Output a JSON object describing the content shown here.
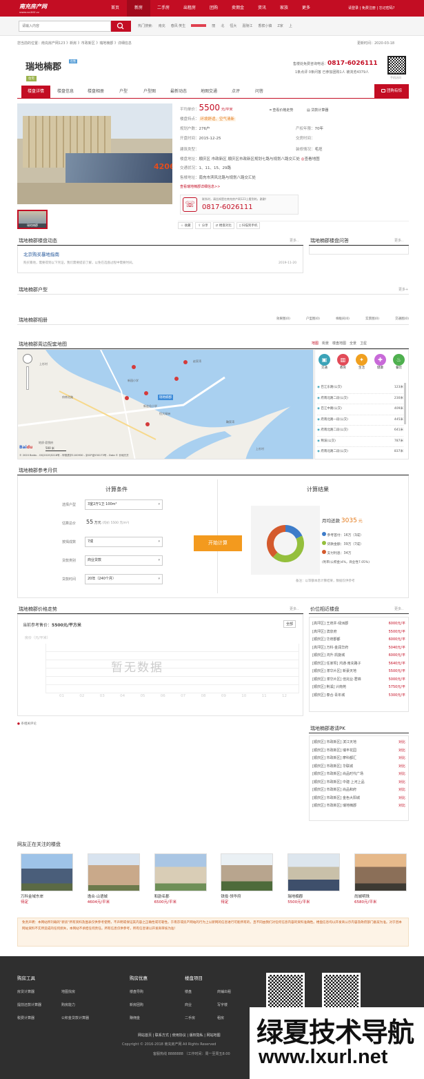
{
  "site": {
    "logo": "南充房产网",
    "logo_url": "www.nc365.cc"
  },
  "topnav": {
    "items": [
      "首页",
      "新房",
      "二手房",
      "出租房",
      "团购",
      "卖佣金",
      "资讯",
      "家族",
      "更多"
    ],
    "login": "请登录",
    "register": "免费注册",
    "forgot": "忘记密码?"
  },
  "search": {
    "placeholder": "请输入内容",
    "hot_label": "热门搜索:",
    "hot": [
      "南充",
      "春风·笑生",
      "",
      "丽",
      "北",
      "恒大",
      "嘉陵江",
      "香槟小镇",
      "Z家",
      "上"
    ]
  },
  "breadcrumb": {
    "text": "您当前的位置：南充房产网123 》新房 》市政新区 》瑞地楠郡 》详细信息",
    "update": "更新时间：2020-03-18"
  },
  "project": {
    "name": "瑞地楠郡",
    "tag_sale": "在售",
    "tag_type": "住宅",
    "phone_label": "售楼处免费咨询电话：",
    "phone": "0817-6026111",
    "stats": "1条点评 0条问答 已参加团购1人 被浏览4379人",
    "qr_caption": "手机访问"
  },
  "tabs": [
    "楼盘详情",
    "楼盘信息",
    "楼盘相册",
    "户型",
    "户型图",
    "最新动态",
    "地图交通",
    "点评",
    "问答"
  ],
  "tuangou_btn": "团购有惊",
  "info": {
    "price_label": "平均单价：",
    "price": "5500",
    "price_unit": "元/平米",
    "price_trend": "查看价格走势",
    "loan_calc": "贷款计算器",
    "feature_label": "楼盘特点：",
    "features": "环境舒适、空气清新",
    "households_label": "规划户数：",
    "households": "276户",
    "years_label": "产权年限：",
    "years": "70年",
    "open_label": "开盘时间：",
    "open": "2015-12-25",
    "deliver_label": "交房时间：",
    "deliver": "",
    "type_label": "建筑类型：",
    "type": "",
    "decor_label": "装修情况：",
    "decor": "毛坯",
    "addr_label": "楼盘地址：",
    "addr": "顺庆区 市政新区 顺庆区市政新区规划七路与规划八路交汇处",
    "map_link": "查看地图",
    "traffic_label": "交通状况：",
    "traffic": "1、11、15、29路",
    "sales_label": "售楼地址：",
    "sales": "南充市滨风北路与规划八路交汇处",
    "detail_link": "查看瑞地楠郡详细信息>>",
    "call_note": "联系时，请告知是在南充房产网123上看到的，谢谢！",
    "call_phone": "0817-6026111",
    "actions": [
      "收藏",
      "分享",
      "楼盘对比",
      "扫描到手机"
    ]
  },
  "photo": {
    "thumb_caption": "瑞地楠郡"
  },
  "dynamic": {
    "title": "瑞地楠郡楼盘动态",
    "more": "更多..",
    "headline": "北京购买暴地指南",
    "summary": "购买暴地，需要得到以下凭证，我们需要提前了解，以免在选盘过程中需要时间。",
    "date": "2019-11-20"
  },
  "qa": {
    "title": "瑞地楠郡楼盘问答",
    "more": "更多.."
  },
  "huxing": {
    "title": "瑞地楠郡户型",
    "more": "更多+"
  },
  "album": {
    "title": "瑞地楠郡相册",
    "tabs": [
      "效果图(0)",
      "户型图(0)",
      "样板间(0)",
      "实景图(0)",
      "交通图(0)"
    ]
  },
  "mapsec": {
    "title": "瑞地楠郡周边配套地图",
    "views": [
      "地图",
      "街景",
      "楼盘地图",
      "全景",
      "卫星"
    ],
    "poi_cats": [
      "交通",
      "教育",
      "生活",
      "健康",
      "餐饮"
    ],
    "poi": [
      {
        "name": "巴江东路(公交)",
        "dist": "123米"
      },
      {
        "name": "府南北路二段(公交)",
        "dist": "230米"
      },
      {
        "name": "巴江中路(公交)",
        "dist": "409米"
      },
      {
        "name": "府南北路一段(公交)",
        "dist": "445米"
      },
      {
        "name": "府南北路二段(公交)",
        "dist": "641米"
      },
      {
        "name": "荆溪(公交)",
        "dist": "787米"
      },
      {
        "name": "府南北路二段(公交)",
        "dist": "837米"
      }
    ],
    "marker": "瑞地楠郡",
    "copyright": "© 2020 Baidu - GS(2019)5218号 - 甲测资字1100930 - 京ICP证030173号 - Data © 长地万方",
    "scale": "500 米",
    "places": [
      "上杉村",
      "赵家湾",
      "新园小学",
      "府南北路",
      "新宏佳小学",
      "恒大绿洲",
      "地质·君悦府",
      "鞠家湾",
      "上杉村"
    ]
  },
  "calc": {
    "title": "瑞地楠郡参考月供",
    "cond_title": "计算条件",
    "result_title": "计算结果",
    "rows": [
      {
        "label": "选择户型",
        "value": "3室2厅1卫 100m²"
      },
      {
        "label": "估算总价",
        "value": "55",
        "unit": "万元",
        "note": "(均价 5500 元/m²)"
      },
      {
        "label": "按揭成数",
        "value": "7成"
      },
      {
        "label": "贷款类别",
        "value": "商业贷款"
      },
      {
        "label": "贷款时间",
        "value": "20年（240个月）"
      }
    ],
    "btn": "开始计算",
    "monthly_label": "月均还款",
    "monthly": "3035",
    "monthly_unit": "元",
    "legend": [
      {
        "label": "参考首付：",
        "value": "16万（3成）",
        "color": "#3d7cc9"
      },
      {
        "label": "贷款金额：",
        "value": "39万（7成）",
        "color": "#94bf3c"
      },
      {
        "label": "支付利息：",
        "value": "34万",
        "color": "#d45a2d"
      }
    ],
    "rate": "(利率(公积金)4%，商业性7.05%)",
    "note": "备注：以等额本息计算结果，数据仅供参考"
  },
  "trend": {
    "title": "瑞地楠郡价格走势",
    "more": "更多..",
    "current_label": "当前参考售价：",
    "current": "5500元/平方米",
    "all_btn": "全部",
    "y_label": "房价（元/平米）",
    "nodata": "暂无数据",
    "months": [
      "01",
      "02",
      "03",
      "04",
      "05",
      "06",
      "07",
      "08",
      "09",
      "10",
      "11",
      "12"
    ],
    "note": "条相关评论"
  },
  "similar": {
    "title": "价位相近楼盘",
    "more": "更多..",
    "items": [
      [
        "[高坪区] 王府井·绿洲郡",
        "6000元/平"
      ],
      [
        "[高坪区] 滨泉府",
        "5500元/平"
      ],
      [
        "[顺庆区] 华府郡都",
        "6000元/平"
      ],
      [
        "[高坪区] 万科·金润华府",
        "5040元/平"
      ],
      [
        "[顺庆区] 鸿升·凯旋城",
        "6000元/平"
      ],
      [
        "[顺庆区] 任家坝] 鸿通·南充路子",
        "5640元/平"
      ],
      [
        "[顺庆区] 潆华片区] 新豪天地",
        "5500元/平"
      ],
      [
        "[顺庆区] 潆华片区] 佳兆业·君锦",
        "5000元/平"
      ],
      [
        "[顺庆区] 荆溪] 兴南苑",
        "5750元/平"
      ],
      [
        "[顺庆区] 泰合·青年城",
        "5300元/平"
      ]
    ]
  },
  "pk": {
    "title": "瑞地楠郡邀请PK",
    "items": [
      [
        "[顺庆区] 市政新区] 滨江天地",
        "对比"
      ],
      [
        "[顺庆区] 市政新区] 瑞丰花园",
        "对比"
      ],
      [
        "[顺庆区] 市政新区] 摩科都汇",
        "对比"
      ],
      [
        "[顺庆区] 市政新区] 华联城",
        "对比"
      ],
      [
        "[顺庆区] 市政新区] 尚品时代广场",
        "对比"
      ],
      [
        "[顺庆区] 市政新区] 中建·上河上品",
        "对比"
      ],
      [
        "[顺庆区] 市政新区] 尚品和府",
        "对比"
      ],
      [
        "[顺庆区] 市政新区] 金色大阳城",
        "对比"
      ],
      [
        "[顺庆区] 市政新区] 瑞地楠郡",
        "对比"
      ]
    ]
  },
  "watching": {
    "title": "网友正在关注的楼盘",
    "items": [
      {
        "name": "万科金域东岸",
        "price": "待定"
      },
      {
        "name": "逸合·山语城",
        "price": "4604元/平米"
      },
      {
        "name": "和韵名郡",
        "price": "6500元/平米"
      },
      {
        "name": "铁投·领华府",
        "price": "待定"
      },
      {
        "name": "瑞地楠郡",
        "price": "5500元/平米"
      },
      {
        "name": "尚城明珠",
        "price": "6580元/平米"
      }
    ]
  },
  "disclaimer": "免责声明：本网站所刊载的\"新房\"所有资料及图表仅供参考使用，不声明或保证其内容之正确性或可靠性。于南京或房产网站的行为上以新网的信息进行可能所有的，且不同由我们对任何信息内容的资料准确性。楼盘信息均以开发商公示内容及政府部门备案为准。对于因本网站资料不实所造成的任何损失，本网站不承担任何责任。所有信息仅供参考，所有信息请以开发商审核为准！",
  "footer": {
    "cols": [
      {
        "title": "购房工具",
        "links": [
          "房贷计算器",
          "地图找房",
          "提前还款计算器",
          "购房能力",
          "税费计算器",
          "公积金贷款计算器"
        ]
      },
      {
        "title": "购房优惠",
        "links": [
          "楼盘导购",
          "新房团购",
          "赚佣金"
        ]
      },
      {
        "title": "楼盘项目",
        "links": [
          "楼盘",
          "商铺出租",
          "商业",
          "写字楼",
          "二手房",
          "租房"
        ]
      }
    ],
    "links": [
      "网站首页",
      "联系方式",
      "使用协议",
      "版权隐私",
      "网站地图"
    ],
    "copyright": "Copyright © 2016-2018 南充房产网 All Rights Reserved",
    "hotline": "客服热线 8888888 （工作时间：周一至周五8:00"
  },
  "watermark": {
    "line1": "绿夏技术导航",
    "line2": "www.lxurl.net"
  }
}
